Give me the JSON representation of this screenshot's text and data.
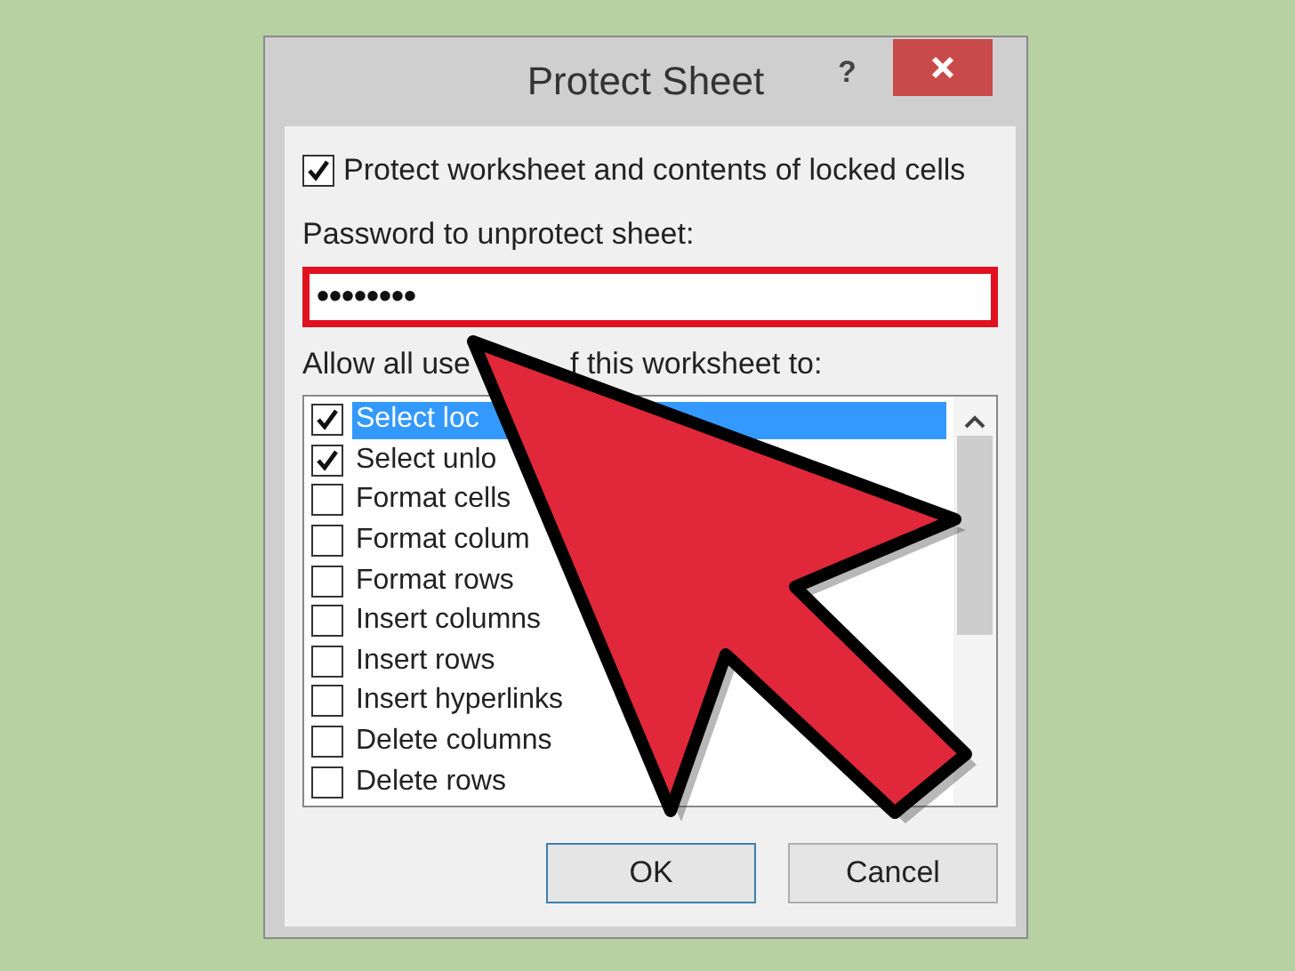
{
  "window": {
    "title": "Protect Sheet",
    "help": "?"
  },
  "protect": {
    "label": "Protect worksheet and contents of locked cells",
    "checked": true
  },
  "password": {
    "label": "Password to unprotect sheet:",
    "value": "••••••••",
    "highlighted": true
  },
  "allow_label": [
    "Allow all use",
    "f this worksheet to:"
  ],
  "permissions": [
    {
      "label": "Select loc",
      "checked": true,
      "selected": true
    },
    {
      "label": "Select unlo",
      "checked": true,
      "selected": false
    },
    {
      "label": "Format cells",
      "checked": false,
      "selected": false
    },
    {
      "label": "Format colum",
      "checked": false,
      "selected": false
    },
    {
      "label": "Format rows",
      "checked": false,
      "selected": false
    },
    {
      "label": "Insert columns",
      "checked": false,
      "selected": false
    },
    {
      "label": "Insert rows",
      "checked": false,
      "selected": false
    },
    {
      "label": "Insert hyperlinks",
      "checked": false,
      "selected": false
    },
    {
      "label": "Delete columns",
      "checked": false,
      "selected": false
    },
    {
      "label": "Delete rows",
      "checked": false,
      "selected": false
    }
  ],
  "buttons": [
    "OK",
    "Cancel"
  ]
}
